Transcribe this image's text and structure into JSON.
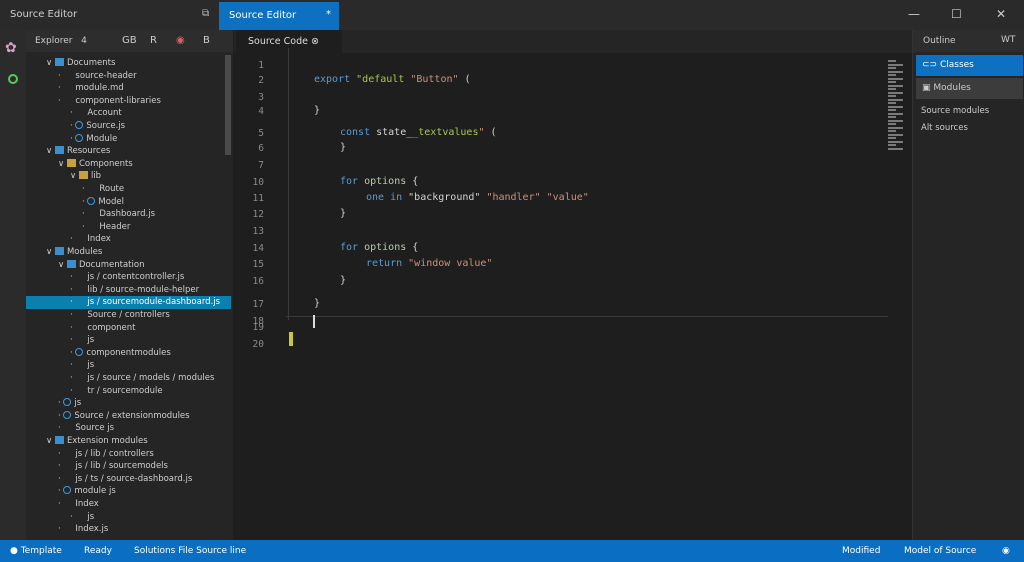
{
  "title_bar": {
    "app_title": "Source Editor",
    "tab_label": "Source Editor",
    "tab_modified": "*",
    "layout_icon": "layout-icon",
    "controls": [
      "—",
      "☐",
      "✕"
    ]
  },
  "activity_bar": {
    "icons": [
      "extensions-icon",
      "status-icon"
    ]
  },
  "sidebar": {
    "title": "Explorer",
    "count": "4",
    "header_icons": [
      "new-file-icon",
      "new-folder-icon",
      "refresh-icon",
      "collapse-icon"
    ],
    "header_glyphs": [
      "GB",
      "R",
      "◉",
      "B"
    ],
    "items": [
      {
        "label": "Documents",
        "indent": 1,
        "icon": "folder"
      },
      {
        "label": "source-header",
        "indent": 2,
        "icon": "file"
      },
      {
        "label": "module.md",
        "indent": 2,
        "icon": "file"
      },
      {
        "label": "component-libraries",
        "indent": 2,
        "icon": "file"
      },
      {
        "label": "Account",
        "indent": 3,
        "icon": "file"
      },
      {
        "label": "Source.js",
        "indent": 3,
        "icon": "circ"
      },
      {
        "label": "Module",
        "indent": 3,
        "icon": "circ"
      },
      {
        "label": "Resources",
        "indent": 1,
        "icon": "folder"
      },
      {
        "label": "Components",
        "indent": 2,
        "icon": "yfolder"
      },
      {
        "label": "lib",
        "indent": 3,
        "icon": "yfolder"
      },
      {
        "label": "Route",
        "indent": 4,
        "icon": "file"
      },
      {
        "label": "Model",
        "indent": 4,
        "icon": "circ"
      },
      {
        "label": "Dashboard.js",
        "indent": 4,
        "icon": "file"
      },
      {
        "label": "Header",
        "indent": 4,
        "icon": "file"
      },
      {
        "label": "Index",
        "indent": 3,
        "icon": "file"
      },
      {
        "label": "Modules",
        "indent": 1,
        "icon": "folder"
      },
      {
        "label": "Documentation",
        "indent": 2,
        "icon": "folder"
      },
      {
        "label": "js / contentcontroller.js",
        "indent": 3,
        "icon": "file"
      },
      {
        "label": "lib / source-module-helper",
        "indent": 3,
        "icon": "file"
      },
      {
        "label": "js / sourcemodule-dashboard.js",
        "indent": 3,
        "icon": "file",
        "selected": true
      },
      {
        "label": "Source / controllers",
        "indent": 3,
        "icon": "file"
      },
      {
        "label": "component",
        "indent": 3,
        "icon": "file"
      },
      {
        "label": "js",
        "indent": 3,
        "icon": "file"
      },
      {
        "label": "componentmodules",
        "indent": 3,
        "icon": "circ"
      },
      {
        "label": "js",
        "indent": 3,
        "icon": "file"
      },
      {
        "label": "js / source / models / modules",
        "indent": 3,
        "icon": "file"
      },
      {
        "label": "tr / sourcemodule",
        "indent": 3,
        "icon": "file"
      },
      {
        "label": "js",
        "indent": 2,
        "icon": "circ"
      },
      {
        "label": "Source / extensionmodules",
        "indent": 2,
        "icon": "circ"
      },
      {
        "label": "Source js",
        "indent": 2,
        "icon": "file"
      },
      {
        "label": "Extension modules",
        "indent": 1,
        "icon": "folder"
      },
      {
        "label": "js / lib / controllers",
        "indent": 2,
        "icon": "file"
      },
      {
        "label": "js / lib / sourcemodels",
        "indent": 2,
        "icon": "file"
      },
      {
        "label": "js / ts / source-dashboard.js",
        "indent": 2,
        "icon": "file"
      },
      {
        "label": "module js",
        "indent": 2,
        "icon": "circ"
      },
      {
        "label": "Index",
        "indent": 2,
        "icon": "file"
      },
      {
        "label": "js",
        "indent": 3,
        "icon": "file"
      },
      {
        "label": "Index.js",
        "indent": 2,
        "icon": "file"
      }
    ]
  },
  "editor": {
    "tab_label": "Source Code",
    "lines": [
      {
        "n": "1",
        "code": []
      },
      {
        "n": "2",
        "code": [
          {
            "c": "kw",
            "t": "export "
          },
          {
            "c": "lit",
            "t": "\"default "
          },
          {
            "c": "str",
            "t": "\"Button\" "
          },
          {
            "c": "",
            "t": "("
          }
        ],
        "ind": 0
      },
      {
        "n": "3",
        "code": []
      },
      {
        "n": "4",
        "code": [
          {
            "c": "",
            "t": "}"
          }
        ],
        "ind": 0
      },
      {
        "n": "5",
        "code": [
          {
            "c": "kw",
            "t": "const "
          },
          {
            "c": "",
            "t": "state_"
          },
          {
            "c": "lit",
            "t": "_textvalues"
          },
          {
            "c": "str",
            "t": "\" "
          },
          {
            "c": "",
            "t": "("
          }
        ],
        "ind": 1
      },
      {
        "n": "6",
        "code": [
          {
            "c": "",
            "t": "}"
          }
        ],
        "ind": 1
      },
      {
        "n": "7",
        "code": []
      },
      {
        "n": "10",
        "code": [
          {
            "c": "kw",
            "t": "for "
          },
          {
            "c": "fn",
            "t": "options "
          },
          {
            "c": "",
            "t": "{"
          }
        ],
        "ind": 1
      },
      {
        "n": "11",
        "code": [
          {
            "c": "kw",
            "t": "one in "
          },
          {
            "c": "",
            "t": "\"background\" "
          },
          {
            "c": "str",
            "t": "\"handler\" \"value\""
          }
        ],
        "ind": 2
      },
      {
        "n": "12",
        "code": [
          {
            "c": "",
            "t": "}"
          }
        ],
        "ind": 1
      },
      {
        "n": "13",
        "code": []
      },
      {
        "n": "14",
        "code": [
          {
            "c": "kw",
            "t": "for "
          },
          {
            "c": "fn",
            "t": "options "
          },
          {
            "c": "",
            "t": "{"
          }
        ],
        "ind": 1
      },
      {
        "n": "15",
        "code": [
          {
            "c": "kw",
            "t": "return "
          },
          {
            "c": "str",
            "t": "\"window value\""
          }
        ],
        "ind": 2
      },
      {
        "n": "16",
        "code": [
          {
            "c": "",
            "t": "}"
          }
        ],
        "ind": 1
      },
      {
        "n": "17",
        "code": [
          {
            "c": "",
            "t": "}"
          }
        ],
        "ind": 0
      },
      {
        "n": "18",
        "code": []
      },
      {
        "n": "19",
        "code": []
      },
      {
        "n": "20",
        "code": []
      }
    ]
  },
  "outline": {
    "title": "Outline",
    "title_icon": "WT",
    "items": [
      {
        "label": "Classes",
        "icon": "class-icon"
      },
      {
        "label": "Modules",
        "icon": "module-icon"
      }
    ],
    "texts": [
      "Source modules",
      "Alt sources"
    ]
  },
  "status_bar": {
    "left": [
      "Template",
      "Ready",
      "Solutions File Source line"
    ],
    "right": [
      "Modified",
      "Model of Source"
    ],
    "icon": "notification-icon"
  },
  "colors": {
    "accent": "#0e70c0",
    "status": "#0a6fc2",
    "selected": "#0b7fae"
  }
}
